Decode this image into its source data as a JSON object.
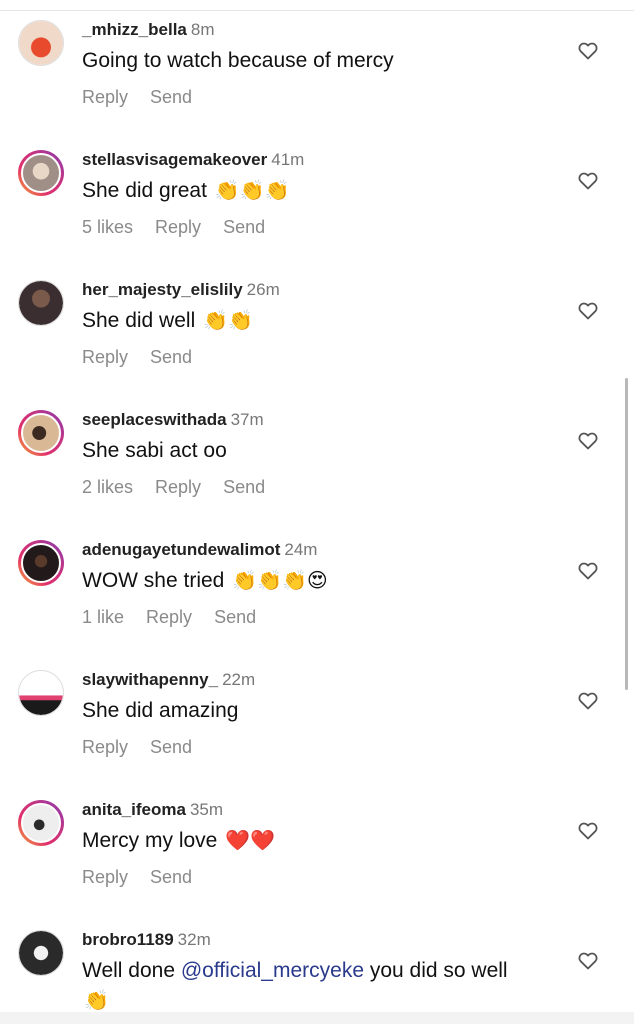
{
  "comments": [
    {
      "username": "_mhizz_bella",
      "time": "8m",
      "text": "Going to watch because of mercy",
      "emojis": "",
      "likes": "",
      "reply": "Reply",
      "send": "Send",
      "avatar_color": "#e9c6b4"
    },
    {
      "username": "stellasvisagemakeover",
      "time": "41m",
      "text": "She did great",
      "emojis": "👏👏👏",
      "likes": "5 likes",
      "reply": "Reply",
      "send": "Send",
      "avatar_color": "#b9a8a1"
    },
    {
      "username": "her_majesty_elislily",
      "time": "26m",
      "text": "She did well",
      "emojis": "👏👏",
      "likes": "",
      "reply": "Reply",
      "send": "Send",
      "avatar_color": "#4a3a3a"
    },
    {
      "username": "seeplaceswithada",
      "time": "37m",
      "text": "She sabi act oo",
      "emojis": "",
      "likes": "2 likes",
      "reply": "Reply",
      "send": "Send",
      "avatar_color": "#c9a07a"
    },
    {
      "username": "adenugayetundewalimot",
      "time": "24m",
      "text": "WOW she tried",
      "emojis": "👏👏👏😍",
      "likes": "1 like",
      "reply": "Reply",
      "send": "Send",
      "avatar_color": "#3a2a2a"
    },
    {
      "username": "slaywithapenny_",
      "time": "22m",
      "text": "She did amazing",
      "emojis": "",
      "likes": "",
      "reply": "Reply",
      "send": "Send",
      "avatar_color": "#f0d0d8"
    },
    {
      "username": "anita_ifeoma",
      "time": "35m",
      "text": "Mercy my love",
      "emojis": "❤️❤️",
      "likes": "",
      "reply": "Reply",
      "send": "Send",
      "avatar_color": "#d8d8d8"
    },
    {
      "username": "brobro1189",
      "time": "32m",
      "text_before": "Well done ",
      "mention": "@official_mercyeke",
      "text_after": " you did so well",
      "emojis": "👏",
      "likes": "",
      "reply": "",
      "send": "",
      "avatar_color": "#2a2a2a"
    }
  ],
  "icons": {
    "like": "heart-outline-icon"
  },
  "colors": {
    "ring_gradient": [
      "#f9b233",
      "#e1306c",
      "#c13584",
      "#833ab4"
    ],
    "mention": "#2a3a8c",
    "meta_text": "#8a8a8a"
  }
}
